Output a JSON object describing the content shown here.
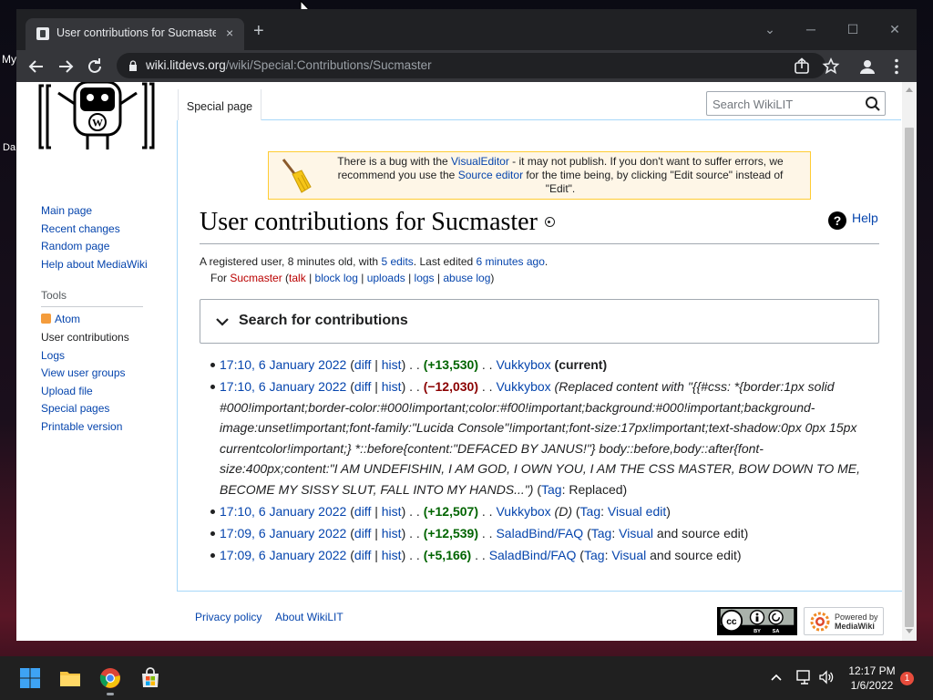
{
  "desktop": {
    "left_labels": [
      "My",
      "Da"
    ]
  },
  "browser": {
    "tab": {
      "title": "User contributions for Sucmaster",
      "close_label": "×"
    },
    "new_tab_label": "+",
    "window_controls": {
      "dropdown": "⌄",
      "minimize": "─",
      "maximize": "☐",
      "close": "✕"
    },
    "url": {
      "host": "wiki.litdevs.org",
      "path": "/wiki/Special:Contributions/Sucmaster"
    }
  },
  "wiki": {
    "tabs": {
      "special_page": "Special page"
    },
    "search": {
      "placeholder": "Search WikiLIT"
    },
    "navigation": [
      {
        "label": "Main page"
      },
      {
        "label": "Recent changes"
      },
      {
        "label": "Random page"
      },
      {
        "label": "Help about MediaWiki"
      }
    ],
    "tools": {
      "title": "Tools",
      "items": [
        {
          "label": "Atom",
          "icon": "rss-icon"
        },
        {
          "label": "User contributions",
          "current": true
        },
        {
          "label": "Logs"
        },
        {
          "label": "View user groups"
        },
        {
          "label": "Upload file"
        },
        {
          "label": "Special pages"
        },
        {
          "label": "Printable version"
        }
      ]
    },
    "sitenotice": {
      "t1": "There is a bug with the ",
      "visual_editor": "VisualEditor",
      "t2": " - it may not publish. If you don't want to suffer errors, we recommend you use the ",
      "source_editor": "Source editor",
      "t3": " for the time being, by clicking \"Edit source\" instead of \"Edit\"."
    },
    "heading": "User contributions for Sucmaster",
    "help": "Help",
    "content_sub": {
      "s1": "A registered user, 8 minutes old, with ",
      "edits": "5 edits",
      "s2": ". Last edited ",
      "last_edited": "6 minutes ago",
      "s3": ".",
      "for": "For ",
      "user": "Sucmaster",
      "open": " (",
      "talk": "talk",
      "sep": " | ",
      "block_log": "block log",
      "uploads": "uploads",
      "logs": "logs",
      "abuse_log": "abuse log",
      "close": ")"
    },
    "search_contributions": "Search for contributions",
    "contributions": [
      {
        "date": "17:10, 6 January 2022",
        "diff": "diff",
        "hist": "hist",
        "size": "(+13,530)",
        "sign": "plus",
        "page": "Vukkybox",
        "current": "(current)"
      },
      {
        "date": "17:10, 6 January 2022",
        "diff": "diff",
        "hist": "hist",
        "size": "(−12,030)",
        "sign": "minus",
        "page": "Vukkybox",
        "comment": "(Replaced content with \"{{#css: *{border:1px solid #000!important;border-color:#000!important;color:#f00!important;background:#000!important;background-image:unset!important;font-family:\"Lucida Console\"!important;font-size:17px!important;text-shadow:0px 0px 15px currentcolor!important;} *::before{content:\"DEFACED BY JANUS!\"} body::before,body::after{font-size:400px;content:\"I AM UNDEFISHIN, I AM GOD, I OWN YOU, I AM THE CSS MASTER, BOW DOWN TO ME, BECOME MY SISSY SLUT, FALL INTO MY HANDS...\")",
        "tag_label": "Tag",
        "tag_value": "Replaced"
      },
      {
        "date": "17:10, 6 January 2022",
        "diff": "diff",
        "hist": "hist",
        "size": "(+12,507)",
        "sign": "plus",
        "page": "Vukkybox",
        "comment": "(D)",
        "tag_label": "Tag",
        "tag_value": "Visual edit"
      },
      {
        "date": "17:09, 6 January 2022",
        "diff": "diff",
        "hist": "hist",
        "size": "(+12,539)",
        "sign": "plus",
        "page": "SaladBind/FAQ",
        "tag_label": "Tag",
        "tag_value": "Visual",
        "tag_extra": " and source edit)"
      },
      {
        "date": "17:09, 6 January 2022",
        "diff": "diff",
        "hist": "hist",
        "size": "(+5,166)",
        "sign": "plus",
        "page": "SaladBind/FAQ",
        "tag_label": "Tag",
        "tag_value": "Visual",
        "tag_extra": " and source edit)"
      }
    ],
    "footer": {
      "privacy": "Privacy policy",
      "about": "About WikiLIT",
      "cc_badge": {
        "by": "BY",
        "sa": "SA"
      },
      "mw_badge": {
        "line1": "Powered by",
        "line2": "MediaWiki"
      }
    }
  },
  "taskbar": {
    "time": "12:17 PM",
    "date": "1/6/2022",
    "notifications": "1"
  }
}
